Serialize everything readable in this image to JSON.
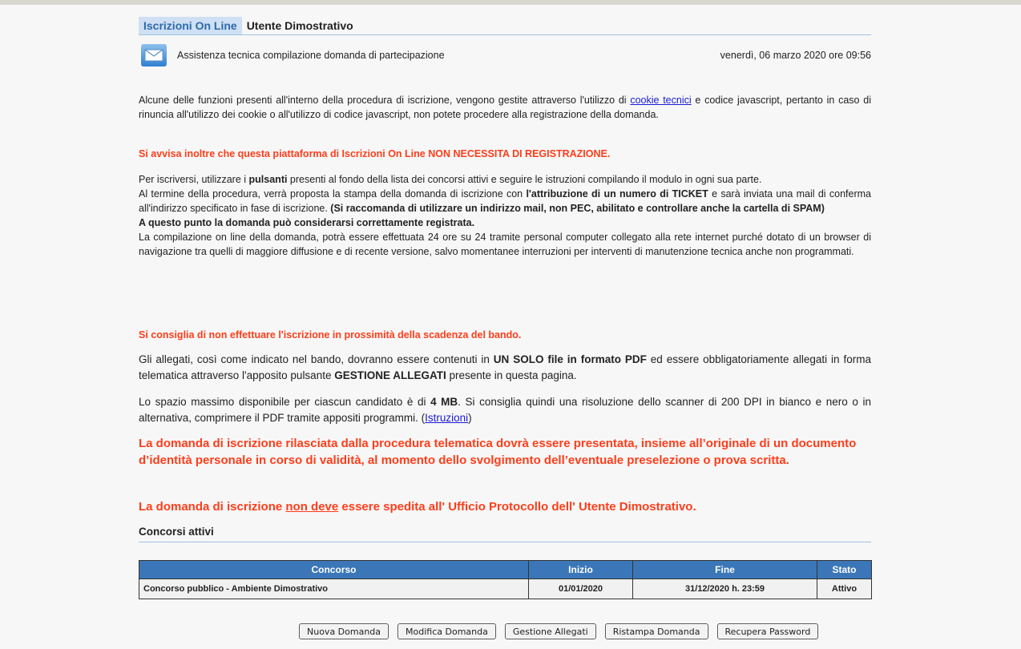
{
  "header": {
    "tab_active": "Iscrizioni On Line",
    "user": "Utente Dimostrativo",
    "title": "Assistenza tecnica compilazione domanda di partecipazione",
    "date": "venerdì, 06 marzo 2020 ore 09:56"
  },
  "intro": {
    "p1_a": "Alcune delle funzioni presenti all'interno della procedura di iscrizione, vengono gestite attraverso l'utilizzo di ",
    "p1_link": "cookie tecnici",
    "p1_b": " e codice javascript, pertanto in caso di rinuncia all'utilizzo dei cookie o all'utilizzo di codice javascript, non potete procedere alla registrazione della domanda.",
    "notice_registration": "Si avvisa inoltre che questa piattaforma di Iscrizioni On Line NON NECESSITA DI REGISTRAZIONE.",
    "p2_a": "Per iscriversi, utilizzare i ",
    "p2_b": "pulsanti",
    "p2_c": " presenti al fondo della lista dei concorsi attivi e seguire le istruzioni compilando il modulo in ogni sua parte.",
    "p3_a": "Al termine della procedura, verrà proposta la stampa della domanda di iscrizione con ",
    "p3_b": "l'attribuzione di un numero di TICKET",
    "p3_c": " e sarà inviata una mail di conferma all'indirizzo specificato in fase di iscrizione. ",
    "p3_d": "(Si raccomanda di utilizzare un indirizzo mail, non PEC, abilitato e controllare anche la cartella di SPAM)",
    "p4": "A questo punto la domanda può considerarsi correttamente registrata.",
    "p5": "La compilazione on line della domanda, potrà essere effettuata 24 ore su 24 tramite personal computer collegato alla rete internet purché dotato di un browser di navigazione tra quelli di maggiore diffusione e di recente versione, salvo momentanee interruzioni per interventi di manutenzione tecnica anche non programmati.",
    "notice_deadline": "Si consiglia di non effettuare l'iscrizione in prossimità della scadenza del bando.",
    "p6_a": "Gli allegati, così come indicato nel bando, dovranno essere contenuti in ",
    "p6_b": "UN SOLO file in formato PDF",
    "p6_c": " ed essere obbligatoriamente allegati in forma telematica attraverso l'apposito pulsante ",
    "p6_d": "GESTIONE ALLEGATI",
    "p6_e": " presente in questa pagina.",
    "p7_a": "Lo spazio massimo disponibile per ciascun candidato è di ",
    "p7_b": "4 MB",
    "p7_c": ". Si consiglia quindi una risoluzione dello scanner di 200 DPI in bianco e nero o in alternativa, comprimere il PDF tramite appositi programmi. (",
    "p7_link": "Istruzioni",
    "p7_d": ")",
    "warning_1": "La domanda di iscrizione rilasciata dalla procedura telematica dovrà essere presentata, insieme all’originale di un documento d’identità personale in corso di validità, al momento dello svolgimento dell’eventuale preselezione o prova scritta.",
    "warning_2_a": "La domanda di iscrizione ",
    "warning_2_u": "non deve",
    "warning_2_b": " essere spedita all' Ufficio Protocollo dell' Utente Dimostrativo."
  },
  "contests": {
    "section_title": "Concorsi attivi",
    "columns": [
      "Concorso",
      "Inizio",
      "Fine",
      "Stato"
    ],
    "rows": [
      [
        "Concorso pubblico - Ambiente Dimostrativo",
        "01/01/2020",
        "31/12/2020 h. 23:59",
        "Attivo"
      ]
    ]
  },
  "buttons": {
    "new": "Nuova Domanda",
    "edit": "Modifica Domanda",
    "attachments": "Gestione Allegati",
    "reprint": "Ristampa Domanda",
    "password": "Recupera Password"
  },
  "colors": {
    "accent": "#3b77b8",
    "warning": "#ff3d1a",
    "tab_bg": "#cfe0f4"
  }
}
